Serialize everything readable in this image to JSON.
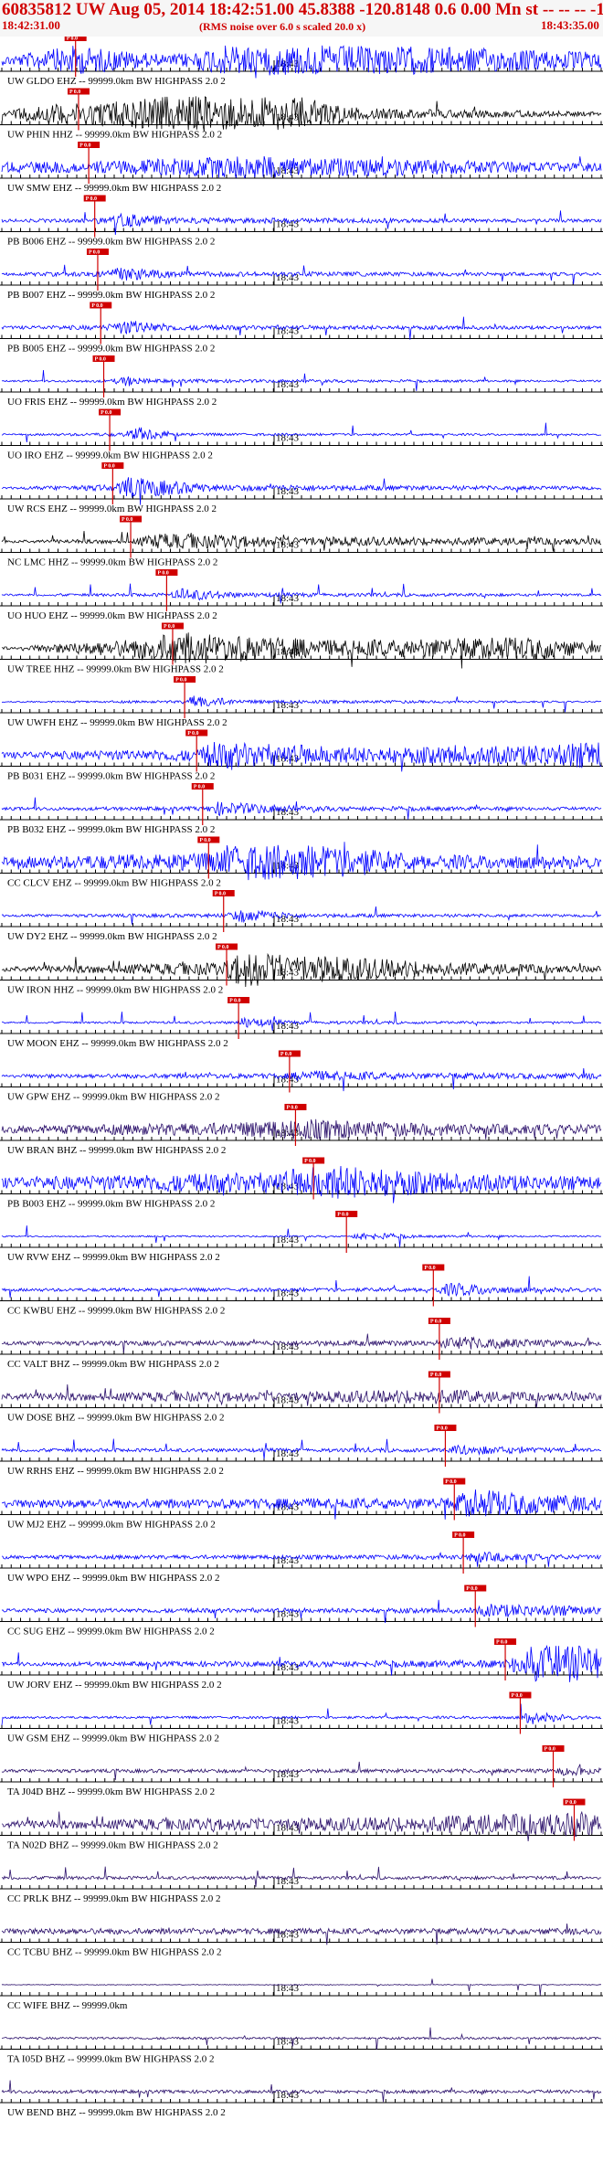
{
  "header": {
    "title": "60835812 UW Aug 05, 2014 18:42:51.00   45.8388 -120.8148  0.6 0.00 Mn st -- -- --  -1",
    "start_time": "18:42:31.00",
    "scale_note": "(RMS noise over 6.0 s scaled 20.0 x)",
    "end_time": "18:43:35.00"
  },
  "minute_label": "18:43",
  "pick_label": "P 0.0",
  "colors": {
    "header_text": "#d00000",
    "header_bg": "#f6f6f6",
    "pick_marker": "#d00000",
    "trace_blue": "#0000ff",
    "trace_black": "#000000",
    "trace_purple": "#2a0f6a",
    "axis": "#000000"
  },
  "traces": [
    {
      "label": "UW GLDO EHZ -- 99999.0km BW  HIGHPASS  2.0  2",
      "color": "blue",
      "pick": 0.123,
      "amp": 0.9,
      "env": [
        [
          0.0,
          0.25
        ],
        [
          0.04,
          0.4
        ],
        [
          0.12,
          0.9
        ],
        [
          0.28,
          0.3
        ],
        [
          0.38,
          0.95
        ],
        [
          0.7,
          0.85
        ],
        [
          1.0,
          0.5
        ]
      ]
    },
    {
      "label": "UW PHIN HHZ -- 99999.0km BW  HIGHPASS  2.0  2",
      "color": "black",
      "pick": 0.128,
      "amp": 1.0,
      "env": [
        [
          0.0,
          0.08
        ],
        [
          0.05,
          0.5
        ],
        [
          0.12,
          0.55
        ],
        [
          0.3,
          1.0
        ],
        [
          0.5,
          0.9
        ],
        [
          0.6,
          0.3
        ],
        [
          1.0,
          0.12
        ]
      ]
    },
    {
      "label": "UW SMW EHZ -- 99999.0km BW  HIGHPASS  2.0  2",
      "color": "blue",
      "pick": 0.145,
      "amp": 0.7,
      "env": [
        [
          0.0,
          0.4
        ],
        [
          0.15,
          0.45
        ],
        [
          0.4,
          0.9
        ],
        [
          0.7,
          0.6
        ],
        [
          1.0,
          0.3
        ]
      ]
    },
    {
      "label": "PB B006 EHZ -- 99999.0km BW  HIGHPASS  2.0  2",
      "color": "blue",
      "pick": 0.155,
      "amp": 0.55,
      "env": [
        [
          0.0,
          0.15
        ],
        [
          0.15,
          0.2
        ],
        [
          0.2,
          0.7
        ],
        [
          0.3,
          0.3
        ],
        [
          1.0,
          0.15
        ]
      ]
    },
    {
      "label": "PB B007 EHZ -- 99999.0km BW  HIGHPASS  2.0  2",
      "color": "blue",
      "pick": 0.16,
      "amp": 0.55,
      "env": [
        [
          0.0,
          0.15
        ],
        [
          0.16,
          0.25
        ],
        [
          0.2,
          0.7
        ],
        [
          0.3,
          0.25
        ],
        [
          1.0,
          0.15
        ]
      ]
    },
    {
      "label": "PB B005 EHZ -- 99999.0km BW  HIGHPASS  2.0  2",
      "color": "blue",
      "pick": 0.165,
      "amp": 0.55,
      "env": [
        [
          0.0,
          0.15
        ],
        [
          0.17,
          0.25
        ],
        [
          0.21,
          0.75
        ],
        [
          0.3,
          0.25
        ],
        [
          1.0,
          0.15
        ]
      ]
    },
    {
      "label": "UO FRIS EHZ -- 99999.0km BW  HIGHPASS  2.0  2",
      "color": "blue",
      "pick": 0.17,
      "amp": 0.5,
      "env": [
        [
          0.0,
          0.08
        ],
        [
          0.18,
          0.15
        ],
        [
          0.21,
          0.6
        ],
        [
          0.25,
          0.2
        ],
        [
          1.0,
          0.1
        ]
      ]
    },
    {
      "label": "UO IRO EHZ -- 99999.0km BW  HIGHPASS  2.0  2",
      "color": "blue",
      "pick": 0.18,
      "amp": 0.5,
      "env": [
        [
          0.0,
          0.08
        ],
        [
          0.2,
          0.2
        ],
        [
          0.23,
          0.8
        ],
        [
          0.3,
          0.15
        ],
        [
          1.0,
          0.1
        ]
      ]
    },
    {
      "label": "UW RCS EHZ -- 99999.0km BW  HIGHPASS  2.0  2",
      "color": "blue",
      "pick": 0.185,
      "amp": 0.6,
      "env": [
        [
          0.0,
          0.1
        ],
        [
          0.19,
          0.3
        ],
        [
          0.21,
          1.0
        ],
        [
          0.35,
          0.3
        ],
        [
          1.0,
          0.15
        ]
      ]
    },
    {
      "label": "NC LMC HHZ -- 99999.0km BW  HIGHPASS  2.0  2",
      "color": "black",
      "pick": 0.215,
      "amp": 0.55,
      "env": [
        [
          0.0,
          0.15
        ],
        [
          0.22,
          0.25
        ],
        [
          0.26,
          0.8
        ],
        [
          0.45,
          0.5
        ],
        [
          1.0,
          0.3
        ]
      ]
    },
    {
      "label": "UO HUO EHZ -- 99999.0km BW  HIGHPASS  2.0  2",
      "color": "blue",
      "pick": 0.275,
      "amp": 0.5,
      "env": [
        [
          0.0,
          0.1
        ],
        [
          0.28,
          0.2
        ],
        [
          0.3,
          0.7
        ],
        [
          0.4,
          0.25
        ],
        [
          1.0,
          0.12
        ]
      ]
    },
    {
      "label": "UW TREE HHZ -- 99999.0km BW  HIGHPASS  2.0  2",
      "color": "black",
      "pick": 0.285,
      "amp": 0.9,
      "env": [
        [
          0.0,
          0.08
        ],
        [
          0.2,
          0.5
        ],
        [
          0.3,
          1.0
        ],
        [
          0.55,
          0.5
        ],
        [
          0.9,
          0.7
        ],
        [
          1.0,
          0.2
        ]
      ]
    },
    {
      "label": "UW UWFH EHZ -- 99999.0km BW  HIGHPASS  2.0  2",
      "color": "blue",
      "pick": 0.305,
      "amp": 0.5,
      "env": [
        [
          0.0,
          0.06
        ],
        [
          0.3,
          0.15
        ],
        [
          0.32,
          0.7
        ],
        [
          0.4,
          0.2
        ],
        [
          1.0,
          0.08
        ]
      ]
    },
    {
      "label": "PB B031 EHZ -- 99999.0km BW  HIGHPASS  2.0  2",
      "color": "blue",
      "pick": 0.325,
      "amp": 0.85,
      "env": [
        [
          0.0,
          0.2
        ],
        [
          0.33,
          0.4
        ],
        [
          0.35,
          0.9
        ],
        [
          0.6,
          0.5
        ],
        [
          0.85,
          0.6
        ],
        [
          1.0,
          0.9
        ]
      ]
    },
    {
      "label": "PB B032 EHZ -- 99999.0km BW  HIGHPASS  2.0  2",
      "color": "blue",
      "pick": 0.335,
      "amp": 0.55,
      "env": [
        [
          0.0,
          0.15
        ],
        [
          0.34,
          0.2
        ],
        [
          0.36,
          0.7
        ],
        [
          0.5,
          0.25
        ],
        [
          1.0,
          0.15
        ]
      ]
    },
    {
      "label": "CC CLCV EHZ -- 99999.0km BW  HIGHPASS  2.0  2",
      "color": "blue",
      "pick": 0.345,
      "amp": 1.0,
      "env": [
        [
          0.0,
          0.3
        ],
        [
          0.35,
          0.5
        ],
        [
          0.38,
          1.0
        ],
        [
          0.55,
          0.9
        ],
        [
          0.7,
          0.4
        ],
        [
          1.0,
          0.35
        ]
      ]
    },
    {
      "label": "UW DY2 EHZ -- 99999.0km BW  HIGHPASS  2.0  2",
      "color": "blue",
      "pick": 0.37,
      "amp": 0.55,
      "env": [
        [
          0.0,
          0.12
        ],
        [
          0.37,
          0.2
        ],
        [
          0.4,
          0.7
        ],
        [
          0.5,
          0.2
        ],
        [
          1.0,
          0.12
        ]
      ]
    },
    {
      "label": "UW IRON HHZ -- 99999.0km BW  HIGHPASS  2.0  2",
      "color": "black",
      "pick": 0.375,
      "amp": 1.0,
      "env": [
        [
          0.0,
          0.15
        ],
        [
          0.37,
          0.35
        ],
        [
          0.4,
          1.0
        ],
        [
          0.55,
          0.7
        ],
        [
          0.75,
          0.35
        ],
        [
          1.0,
          0.15
        ]
      ]
    },
    {
      "label": "UW MOON EHZ -- 99999.0km BW  HIGHPASS  2.0  2",
      "color": "blue",
      "pick": 0.395,
      "amp": 0.5,
      "env": [
        [
          0.0,
          0.08
        ],
        [
          0.39,
          0.15
        ],
        [
          0.4,
          0.6
        ],
        [
          0.48,
          0.2
        ],
        [
          1.0,
          0.08
        ]
      ]
    },
    {
      "label": "UW GPW EHZ -- 99999.0km BW  HIGHPASS  2.0  2",
      "color": "blue",
      "pick": 0.48,
      "amp": 0.5,
      "env": [
        [
          0.0,
          0.2
        ],
        [
          0.48,
          0.3
        ],
        [
          0.5,
          0.6
        ],
        [
          0.7,
          0.35
        ],
        [
          1.0,
          0.3
        ]
      ]
    },
    {
      "label": "UW BRAN BHZ -- 99999.0km BW  HIGHPASS  2.0  2",
      "color": "purple",
      "pick": 0.49,
      "amp": 0.75,
      "env": [
        [
          0.0,
          0.25
        ],
        [
          0.38,
          0.5
        ],
        [
          0.5,
          0.8
        ],
        [
          0.7,
          0.45
        ],
        [
          1.0,
          0.35
        ]
      ]
    },
    {
      "label": "PB B003 EHZ -- 99999.0km BW  HIGHPASS  2.0  2",
      "color": "blue",
      "pick": 0.52,
      "amp": 1.0,
      "env": [
        [
          0.0,
          0.3
        ],
        [
          0.45,
          0.6
        ],
        [
          0.55,
          1.0
        ],
        [
          0.75,
          0.5
        ],
        [
          1.0,
          0.35
        ]
      ]
    },
    {
      "label": "UW RVW EHZ -- 99999.0km BW  HIGHPASS  2.0  2",
      "color": "blue",
      "pick": 0.575,
      "amp": 0.45,
      "env": [
        [
          0.0,
          0.08
        ],
        [
          0.58,
          0.1
        ],
        [
          0.6,
          0.5
        ],
        [
          0.7,
          0.15
        ],
        [
          1.0,
          0.08
        ]
      ]
    },
    {
      "label": "CC KWBU EHZ -- 99999.0km BW  HIGHPASS  2.0  2",
      "color": "blue",
      "pick": 0.72,
      "amp": 0.55,
      "env": [
        [
          0.0,
          0.15
        ],
        [
          0.72,
          0.2
        ],
        [
          0.75,
          0.7
        ],
        [
          0.85,
          0.3
        ],
        [
          1.0,
          0.2
        ]
      ]
    },
    {
      "label": "CC VALT BHZ -- 99999.0km BW  HIGHPASS  2.0  2",
      "color": "purple",
      "pick": 0.73,
      "amp": 0.55,
      "env": [
        [
          0.0,
          0.2
        ],
        [
          0.73,
          0.3
        ],
        [
          0.75,
          0.7
        ],
        [
          0.9,
          0.35
        ],
        [
          1.0,
          0.25
        ]
      ]
    },
    {
      "label": "UW DOSE BHZ -- 99999.0km BW  HIGHPASS  2.0  2",
      "color": "purple",
      "pick": 0.73,
      "amp": 0.6,
      "env": [
        [
          0.0,
          0.35
        ],
        [
          0.5,
          0.45
        ],
        [
          0.74,
          0.7
        ],
        [
          0.85,
          0.4
        ],
        [
          1.0,
          0.35
        ]
      ]
    },
    {
      "label": "UW RRHS EHZ -- 99999.0km BW  HIGHPASS  2.0  2",
      "color": "blue",
      "pick": 0.74,
      "amp": 0.45,
      "env": [
        [
          0.0,
          0.2
        ],
        [
          0.74,
          0.25
        ],
        [
          0.76,
          0.6
        ],
        [
          0.9,
          0.3
        ],
        [
          1.0,
          0.2
        ]
      ]
    },
    {
      "label": "UW MJ2 EHZ -- 99999.0km BW  HIGHPASS  2.0  2",
      "color": "blue",
      "pick": 0.755,
      "amp": 0.9,
      "env": [
        [
          0.0,
          0.25
        ],
        [
          0.75,
          0.35
        ],
        [
          0.78,
          0.9
        ],
        [
          0.9,
          0.6
        ],
        [
          1.0,
          0.4
        ]
      ]
    },
    {
      "label": "UW WPO EHZ -- 99999.0km BW  HIGHPASS  2.0  2",
      "color": "blue",
      "pick": 0.77,
      "amp": 0.5,
      "env": [
        [
          0.0,
          0.2
        ],
        [
          0.77,
          0.25
        ],
        [
          0.78,
          0.65
        ],
        [
          0.9,
          0.3
        ],
        [
          1.0,
          0.2
        ]
      ]
    },
    {
      "label": "CC SUG EHZ -- 99999.0km BW  HIGHPASS  2.0  2",
      "color": "blue",
      "pick": 0.79,
      "amp": 0.55,
      "env": [
        [
          0.0,
          0.2
        ],
        [
          0.79,
          0.25
        ],
        [
          0.81,
          0.7
        ],
        [
          0.95,
          0.5
        ],
        [
          1.0,
          0.3
        ]
      ]
    },
    {
      "label": "UW JORV EHZ -- 99999.0km BW  HIGHPASS  2.0  2",
      "color": "blue",
      "pick": 0.84,
      "amp": 1.0,
      "env": [
        [
          0.0,
          0.1
        ],
        [
          0.84,
          0.2
        ],
        [
          0.88,
          1.0
        ],
        [
          1.0,
          1.0
        ]
      ]
    },
    {
      "label": "UW GSM EHZ -- 99999.0km BW  HIGHPASS  2.0  2",
      "color": "blue",
      "pick": 0.865,
      "amp": 0.5,
      "env": [
        [
          0.0,
          0.12
        ],
        [
          0.86,
          0.15
        ],
        [
          0.88,
          0.7
        ],
        [
          0.95,
          0.25
        ],
        [
          1.0,
          0.15
        ]
      ]
    },
    {
      "label": "TA J04D BHZ -- 99999.0km BW  HIGHPASS  2.0  2",
      "color": "purple",
      "pick": 0.92,
      "amp": 0.45,
      "env": [
        [
          0.0,
          0.2
        ],
        [
          0.92,
          0.25
        ],
        [
          0.94,
          0.6
        ],
        [
          1.0,
          0.4
        ]
      ]
    },
    {
      "label": "TA N02D BHZ -- 99999.0km BW  HIGHPASS  2.0  2",
      "color": "purple",
      "pick": 0.955,
      "amp": 0.75,
      "env": [
        [
          0.0,
          0.3
        ],
        [
          0.6,
          0.5
        ],
        [
          0.9,
          0.8
        ],
        [
          0.97,
          0.9
        ],
        [
          1.0,
          0.7
        ]
      ]
    },
    {
      "label": "CC PRLK BHZ -- 99999.0km BW  HIGHPASS  2.0  2",
      "color": "purple",
      "pick": null,
      "amp": 0.3,
      "env": [
        [
          0.0,
          0.3
        ],
        [
          1.0,
          0.3
        ]
      ]
    },
    {
      "label": "CC TCBU BHZ -- 99999.0km BW  HIGHPASS  2.0  2",
      "color": "purple",
      "pick": null,
      "amp": 0.4,
      "env": [
        [
          0.0,
          0.4
        ],
        [
          1.0,
          0.4
        ]
      ]
    },
    {
      "label": "CC WIFE BHZ -- 99999.0km",
      "color": "purple",
      "pick": null,
      "amp": 0.02,
      "env": [
        [
          0.0,
          1.0
        ],
        [
          1.0,
          1.0
        ]
      ]
    },
    {
      "label": "TA I05D BHZ -- 99999.0km BW  HIGHPASS  2.0  2",
      "color": "purple",
      "pick": null,
      "amp": 0.25,
      "env": [
        [
          0.0,
          0.25
        ],
        [
          1.0,
          0.25
        ]
      ]
    },
    {
      "label": "UW BEND BHZ -- 99999.0km BW  HIGHPASS  2.0  2",
      "color": "purple",
      "pick": null,
      "amp": 0.3,
      "env": [
        [
          0.0,
          0.3
        ],
        [
          1.0,
          0.3
        ]
      ]
    }
  ]
}
